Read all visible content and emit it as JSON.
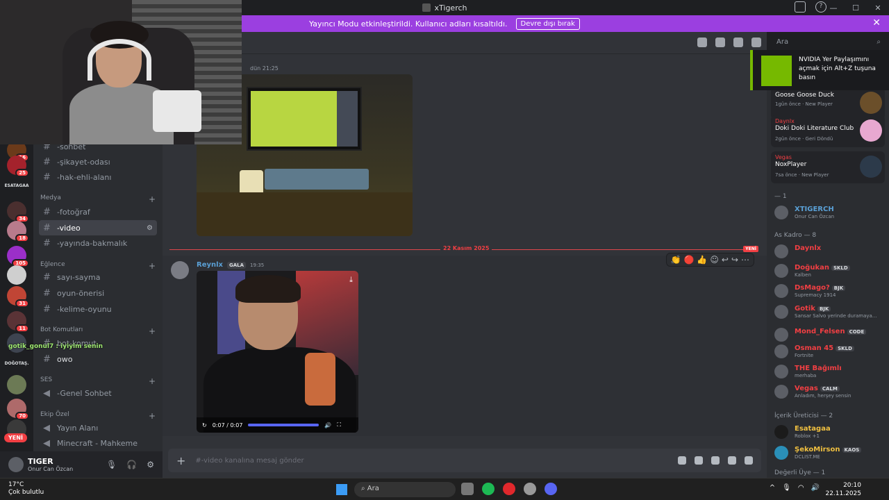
{
  "window": {
    "title": "xTigerch"
  },
  "banner": {
    "text": "Yayıncı Modu etkinleştirildi. Kullanıcı adları kısaltıldı.",
    "button": "Devre dışı bırak"
  },
  "rail": {
    "badges": [
      "16",
      "25",
      "32",
      "34",
      "18",
      "105",
      "31",
      "11",
      "70"
    ],
    "labels": [
      "ESATAGAA",
      "DOĞOTAŞ."
    ],
    "new_label": "YENİ"
  },
  "channels": {
    "items_top": [
      "-sohbet",
      "-şikayet-odası",
      "-hak-ehli-alanı"
    ],
    "cat_media": "Medya",
    "items_media": [
      "-fotoğraf",
      "-video",
      "-yayında-bakmalık"
    ],
    "cat_fun": "Eğlence",
    "items_fun": [
      "sayı-sayma",
      "oyun-önerisi",
      "-kelime-oyunu"
    ],
    "cat_bot": "Bot Komutları",
    "items_bot": [
      "bot-komut",
      "owo"
    ],
    "cat_voice": "SES",
    "items_voice": [
      "-Genel Sohbet"
    ],
    "cat_team": "Ekip Özel",
    "items_team": [
      "Yayın Alanı",
      "Minecraft - Mahkeme"
    ],
    "overlay_chat": "gotik_gonul7 : iyiyim senin"
  },
  "user": {
    "name": "TIGER",
    "status": "Onur Can Özcan"
  },
  "chat": {
    "first_time": "dün 21:25",
    "divider_date": "22 Kasım 2025",
    "new_tag": "YENİ",
    "author": "Reynlx",
    "author_tag": "GALA",
    "author_time": "19:35",
    "video_time": "0:07 / 0:07",
    "composer_placeholder": "#-video kanalına mesaj gönder"
  },
  "search": {
    "placeholder": "Ara"
  },
  "toast": {
    "text": "NVIDIA Yer Paylaşımını açmak için Alt+Z tuşuna basın"
  },
  "activities": [
    {
      "user": "",
      "game": "Goose Goose Duck",
      "meta": "1gün önce · New Player"
    },
    {
      "user": "Daynlx",
      "game": "Doki Doki Literature Club",
      "meta": "2gün önce · Geri Döndü"
    },
    {
      "user": "Vegas",
      "game": "NoxPlayer",
      "meta": "7sa önce · New Player"
    }
  ],
  "members": {
    "group1": "— 1",
    "owner": {
      "name": "XTIGERCH",
      "status": "Onur Can Özcan"
    },
    "group2": "As Kadro — 8",
    "list": [
      {
        "name": "Daynlx",
        "tag": "",
        "status": ""
      },
      {
        "name": "Doğukan",
        "tag": "SKLD",
        "status": "Kalben"
      },
      {
        "name": "DsMago?",
        "tag": "BJK",
        "status": "Supremacy 1914"
      },
      {
        "name": "Gotik",
        "tag": "BJK",
        "status": "Sansar Salvo yerinde duramaya..."
      },
      {
        "name": "Mond_Felsen",
        "tag": "CODE",
        "status": ""
      },
      {
        "name": "Osman 45",
        "tag": "SKLD",
        "status": "Fortnite"
      },
      {
        "name": "THE Bağımlı",
        "tag": "",
        "status": "merhaba"
      },
      {
        "name": "Vegas",
        "tag": "CALM",
        "status": "Anladım, herşey sensin"
      }
    ],
    "group3": "İçerik Üreticisi — 2",
    "creators": [
      {
        "name": "Esatagaa",
        "tag": "",
        "status": "Roblox +1"
      },
      {
        "name": "ŞekoMirson",
        "tag": "KAOS",
        "status": "DCLIST.ME"
      }
    ],
    "group4": "Değerli Üye — 1"
  },
  "taskbar": {
    "temp": "17°C",
    "weather": "Çok bulutlu",
    "search": "Ara",
    "time": "20:10",
    "date": "22.11.2025"
  }
}
